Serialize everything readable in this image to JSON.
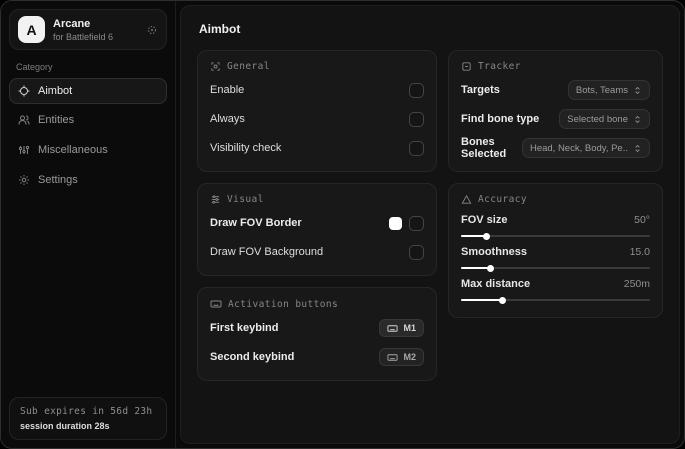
{
  "sidebar": {
    "brand": {
      "initial": "A",
      "title": "Arcane",
      "subtitle": "for Battlefield 6"
    },
    "category_label": "Category",
    "items": [
      {
        "label": "Aimbot",
        "icon": "crosshair-icon",
        "active": true
      },
      {
        "label": "Entities",
        "icon": "users-icon",
        "active": false
      },
      {
        "label": "Miscellaneous",
        "icon": "sliders-icon",
        "active": false
      },
      {
        "label": "Settings",
        "icon": "gear-icon",
        "active": false
      }
    ],
    "footer": {
      "line1": "Sub expires in 56d 23h",
      "line2": "session duration 28s"
    }
  },
  "main": {
    "title": "Aimbot",
    "general": {
      "title": "General",
      "rows": [
        {
          "label": "Enable",
          "checked": false
        },
        {
          "label": "Always",
          "checked": false
        },
        {
          "label": "Visibility check",
          "checked": false
        }
      ]
    },
    "visual": {
      "title": "Visual",
      "rows": [
        {
          "label": "Draw FOV Border",
          "swatch_color": "#ffffff",
          "checked": false
        },
        {
          "label": "Draw FOV Background",
          "checked": false
        }
      ]
    },
    "activation": {
      "title": "Activation buttons",
      "rows": [
        {
          "label": "First keybind",
          "key": "M1"
        },
        {
          "label": "Second keybind",
          "key": "M2"
        }
      ]
    },
    "tracker": {
      "title": "Tracker",
      "rows": [
        {
          "label": "Targets",
          "value": "Bots, Teams"
        },
        {
          "label": "Find bone type",
          "value": "Selected bone"
        },
        {
          "label": "Bones Selected",
          "value": "Head, Neck, Body, Pe.."
        }
      ]
    },
    "accuracy": {
      "title": "Accuracy",
      "sliders": [
        {
          "label": "FOV size",
          "value": "50°",
          "fill_pct": 14
        },
        {
          "label": "Smoothness",
          "value": "15.0",
          "fill_pct": 16
        },
        {
          "label": "Max distance",
          "value": "250m",
          "fill_pct": 22
        }
      ]
    }
  },
  "colors": {
    "fov_border_swatch": "#ffffff",
    "slider_fill": "#ffffff"
  }
}
